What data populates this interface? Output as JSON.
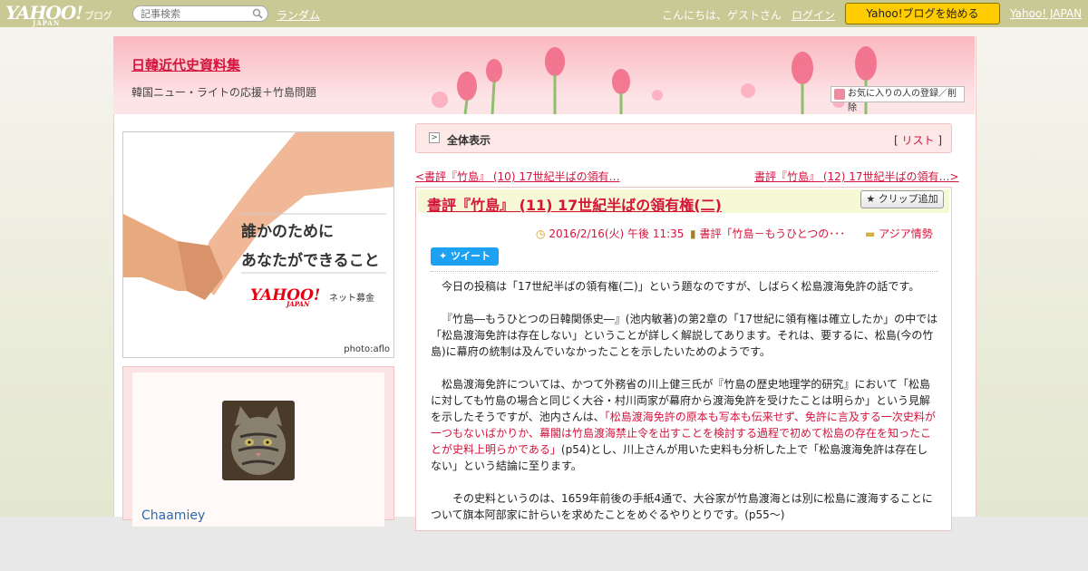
{
  "topbar": {
    "logo_main": "YAHOO!",
    "logo_sub": "ブログ",
    "logo_japan": "JAPAN",
    "search_placeholder": "記事検索",
    "random": "ランダム",
    "greeting": "こんにちは、ゲストさん",
    "login": "ログイン",
    "start_button": "Yahoo!ブログを始める",
    "yahoo_japan": "Yahoo! JAPAN"
  },
  "header": {
    "title": "日韓近代史資料集",
    "description": "韓国ニュー・ライトの応援＋竹島問題",
    "fav_button": "お気に入りの人の登録／削除"
  },
  "ad": {
    "line1": "誰かのために",
    "line2": "あなたができること",
    "logo": "YAHOO!",
    "logo_sub": "JAPAN",
    "net": "ネット募金",
    "photo_credit": "photo:aflo"
  },
  "profile": {
    "username": "Chaamiey"
  },
  "nav": {
    "all_view": "全体表示",
    "list_open": "[ ",
    "list": "リスト",
    "list_close": " ]",
    "prev": "<書評『竹島』 (10) 17世紀半ばの領有…",
    "next": "書評『竹島』 (12) 17世紀半ばの領有…>"
  },
  "entry": {
    "title": "書評『竹島』 (11) 17世紀半ばの領有権(二)",
    "clip_button": "クリップ追加",
    "date": "2016/2/16(火) 午後 11:35",
    "book": "書評「竹島－もうひとつの･･･",
    "category": "アジア情勢",
    "tweet": "ツイート",
    "p1": "今日の投稿は「17世紀半ばの領有権(二)」という題なのですが、しばらく松島渡海免許の話です。",
    "p2": "『竹島―もうひとつの日韓関係史―』(池内敏著)の第2章の「17世紀に領有権は確立したか」の中では「松島渡海免許は存在しない」ということが詳しく解説してあります。それは、要するに、松島(今の竹島)に幕府の統制は及んでいなかったことを示したいためのようです。",
    "p3a": "松島渡海免許については、かつて外務省の川上健三氏が『竹島の歴史地理学的研究』において「松島に対しても竹島の場合と同じく大谷・村川両家が幕府から渡海免許を受けたことは明らか」という見解を示したそうですが、池内さんは、",
    "p3red": "「松島渡海免許の原本も写本も伝来せず、免許に言及する一次史料が一つもないばかりか、幕閣は竹島渡海禁止令を出すことを検討する過程で初めて松島の存在を知ったことが史料上明らかである」",
    "p3b": "(p54)とし、川上さんが用いた史料も分析した上で「松島渡海免許は存在しない」という結論に至ります。",
    "p4": "その史料というのは、1659年前後の手紙4通で、大谷家が竹島渡海とは別に松島に渡海することについて旗本阿部家に計らいを求めたことをめぐるやりとりです。(p55～)"
  }
}
